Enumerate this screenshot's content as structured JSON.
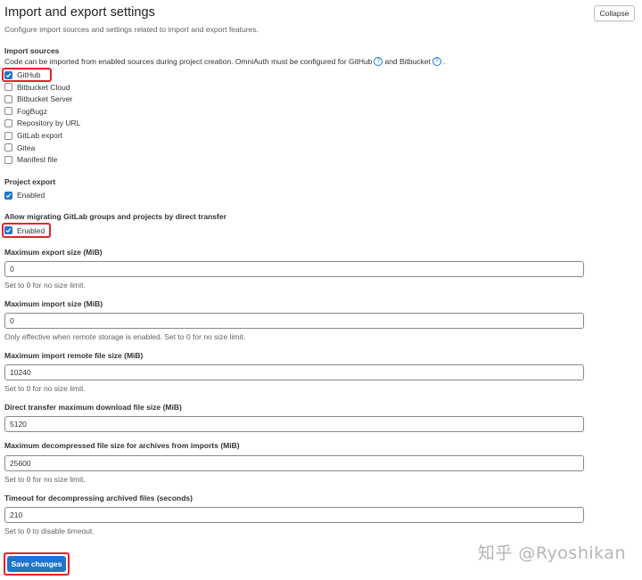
{
  "header": {
    "title": "Import and export settings",
    "description": "Configure import sources and settings related to import and export features.",
    "collapse_label": "Collapse"
  },
  "import_sources": {
    "label": "Import sources",
    "help_prefix": "Code can be imported from enabled sources during project creation. OmniAuth must be configured for GitHub",
    "help_and": "and Bitbucket",
    "help_suffix": ".",
    "help_icon": "?",
    "items": [
      {
        "label": "GitHub",
        "checked": true
      },
      {
        "label": "Bitbucket Cloud",
        "checked": false
      },
      {
        "label": "Bitbucket Server",
        "checked": false
      },
      {
        "label": "FogBugz",
        "checked": false
      },
      {
        "label": "Repository by URL",
        "checked": false
      },
      {
        "label": "GitLab export",
        "checked": false
      },
      {
        "label": "Gitea",
        "checked": false
      },
      {
        "label": "Manifest file",
        "checked": false
      }
    ]
  },
  "project_export": {
    "label": "Project export",
    "enabled_label": "Enabled",
    "checked": true
  },
  "direct_transfer": {
    "label": "Allow migrating GitLab groups and projects by direct transfer",
    "enabled_label": "Enabled",
    "checked": true
  },
  "fields": [
    {
      "label": "Maximum export size (MiB)",
      "value": "0",
      "help": "Set to 0 for no size limit."
    },
    {
      "label": "Maximum import size (MiB)",
      "value": "0",
      "help": "Only effective when remote storage is enabled. Set to 0 for no size limit."
    },
    {
      "label": "Maximum import remote file size (MiB)",
      "value": "10240",
      "help": "Set to 0 for no size limit."
    },
    {
      "label": "Direct transfer maximum download file size (MiB)",
      "value": "5120",
      "help": ""
    },
    {
      "label": "Maximum decompressed file size for archives from imports (MiB)",
      "value": "25600",
      "help": "Set to 0 for no size limit."
    },
    {
      "label": "Timeout for decompressing archived files (seconds)",
      "value": "210",
      "help": "Set to 0 to disable timeout."
    }
  ],
  "save_label": "Save changes",
  "watermark": "知乎 @Ryoshikan",
  "colors": {
    "accent": "#1f75cb",
    "highlight": "#e8202a"
  }
}
